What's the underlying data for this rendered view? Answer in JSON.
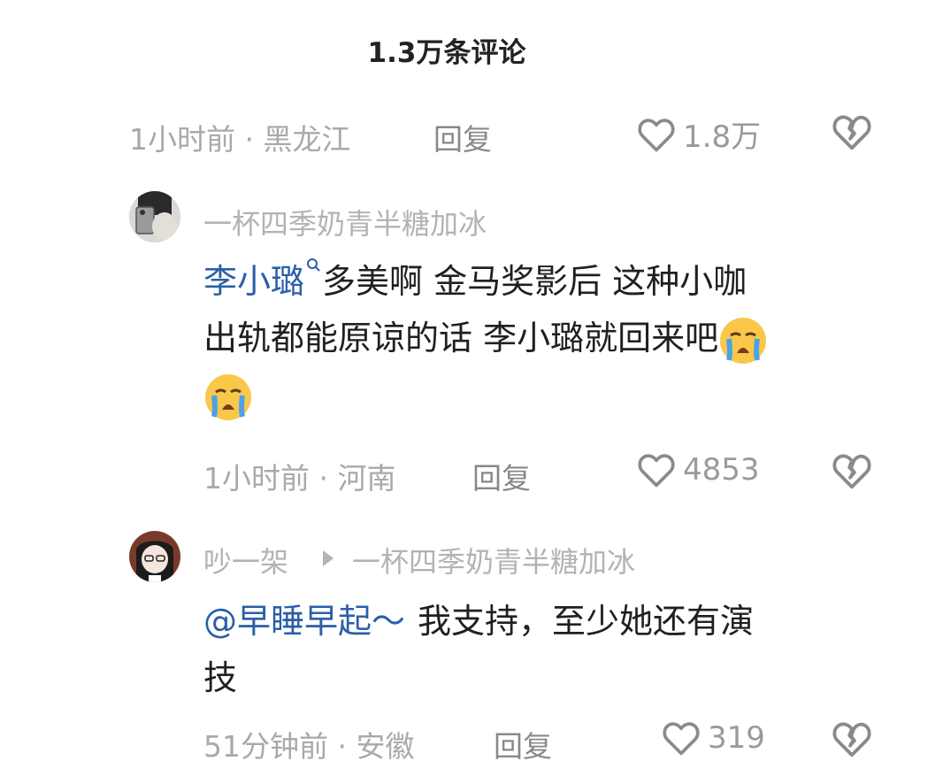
{
  "header": {
    "title": "1.3万条评论"
  },
  "comment0": {
    "meta": "1小时前 · 黑龙江",
    "reply": "回复",
    "likes": "1.8万"
  },
  "comment1": {
    "username": "一杯四季奶青半糖加冰",
    "mention": "李小璐",
    "line1_text": "多美啊 金马奖影后 这种小咖",
    "line2_text": "出轨都能原谅的话 李小璐就回来吧",
    "emoji_name": "loudly-crying-face",
    "meta": "1小时前 · 河南",
    "reply": "回复",
    "likes": "4853"
  },
  "comment2": {
    "username": "吵一架",
    "reply_to": "一杯四季奶青半糖加冰",
    "mention": "@早睡早起～",
    "line1_text": "我支持，至少她还有演",
    "line2_text": "技",
    "meta": "51分钟前 · 安徽",
    "reply": "回复",
    "likes": "319"
  },
  "colors": {
    "mention": "#2b5fa8",
    "meta": "#a9a9a9",
    "text": "#202020"
  }
}
